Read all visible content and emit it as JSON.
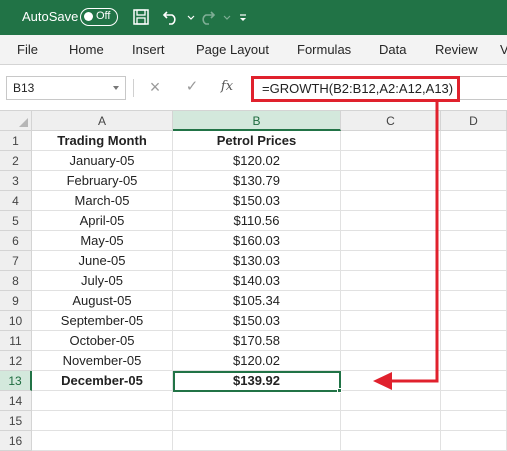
{
  "titlebar": {
    "autosave_label": "AutoSave",
    "autosave_state": "Off",
    "icons": [
      "save-icon",
      "undo-icon",
      "redo-icon",
      "customize-quick-access-icon"
    ]
  },
  "ribbon": {
    "tabs": [
      "File",
      "Home",
      "Insert",
      "Page Layout",
      "Formulas",
      "Data",
      "Review",
      "V"
    ]
  },
  "formula_bar": {
    "name_box": "B13",
    "cancel_icon": "×",
    "enter_icon": "✓",
    "function_icon": "fx",
    "formula": "=GROWTH(B2:B12,A2:A12,A13)"
  },
  "grid": {
    "columns": [
      "A",
      "B",
      "C",
      "D"
    ],
    "rows": [
      "1",
      "2",
      "3",
      "4",
      "5",
      "6",
      "7",
      "8",
      "9",
      "10",
      "11",
      "12",
      "13",
      "14",
      "15",
      "16"
    ],
    "header": {
      "a": "Trading Month",
      "b": "Petrol Prices"
    },
    "data": [
      {
        "a": "January-05",
        "b": "$120.02"
      },
      {
        "a": "February-05",
        "b": "$130.79"
      },
      {
        "a": "March-05",
        "b": "$150.03"
      },
      {
        "a": "April-05",
        "b": "$110.56"
      },
      {
        "a": "May-05",
        "b": "$160.03"
      },
      {
        "a": "June-05",
        "b": "$130.03"
      },
      {
        "a": "July-05",
        "b": "$140.03"
      },
      {
        "a": "August-05",
        "b": "$105.34"
      },
      {
        "a": "September-05",
        "b": "$150.03"
      },
      {
        "a": "October-05",
        "b": "$170.58"
      },
      {
        "a": "November-05",
        "b": "$120.02"
      }
    ],
    "result": {
      "a": "December-05",
      "b": "$139.92"
    },
    "selected_cell": "B13"
  },
  "colors": {
    "accent": "#217346",
    "annotation": "#e0212d"
  }
}
